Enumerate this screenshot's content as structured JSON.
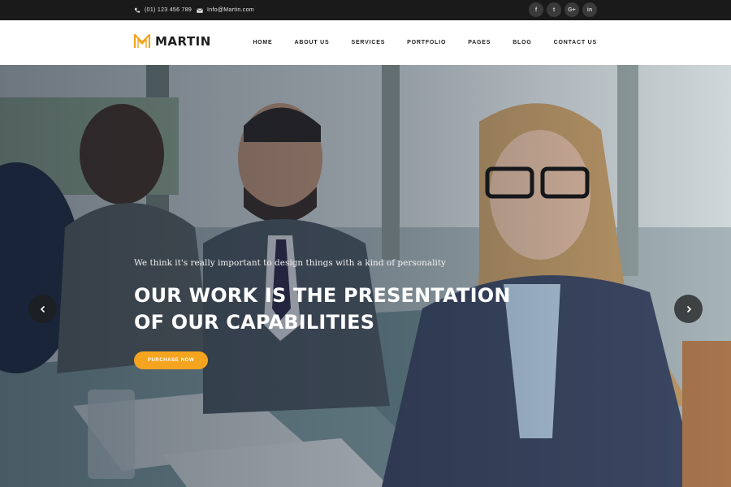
{
  "topbar": {
    "phone": "(01) 123 456 789",
    "email": "Info@Martin.com",
    "socials": [
      {
        "icon": "facebook-icon",
        "glyph": "f"
      },
      {
        "icon": "twitter-icon",
        "glyph": "t"
      },
      {
        "icon": "google-plus-icon",
        "glyph": "G+"
      },
      {
        "icon": "linkedin-icon",
        "glyph": "in"
      }
    ]
  },
  "header": {
    "logo_text": "MARTIN",
    "nav": [
      "HOME",
      "ABOUT US",
      "SERVICES",
      "PORTFOLIO",
      "PAGES",
      "BLOG",
      "CONTACT US"
    ]
  },
  "hero": {
    "kicker": "We think it's really important to design things with a kind of personality",
    "headline_line1": "OUR WORK IS THE PRESENTATION",
    "headline_line2": "OF OUR CAPABILITIES",
    "cta_label": "PURCHASE NOW"
  },
  "colors": {
    "accent": "#f5a41f",
    "topbar_bg": "#1a1a1a",
    "header_bg": "#ffffff",
    "text_dark": "#222222"
  }
}
